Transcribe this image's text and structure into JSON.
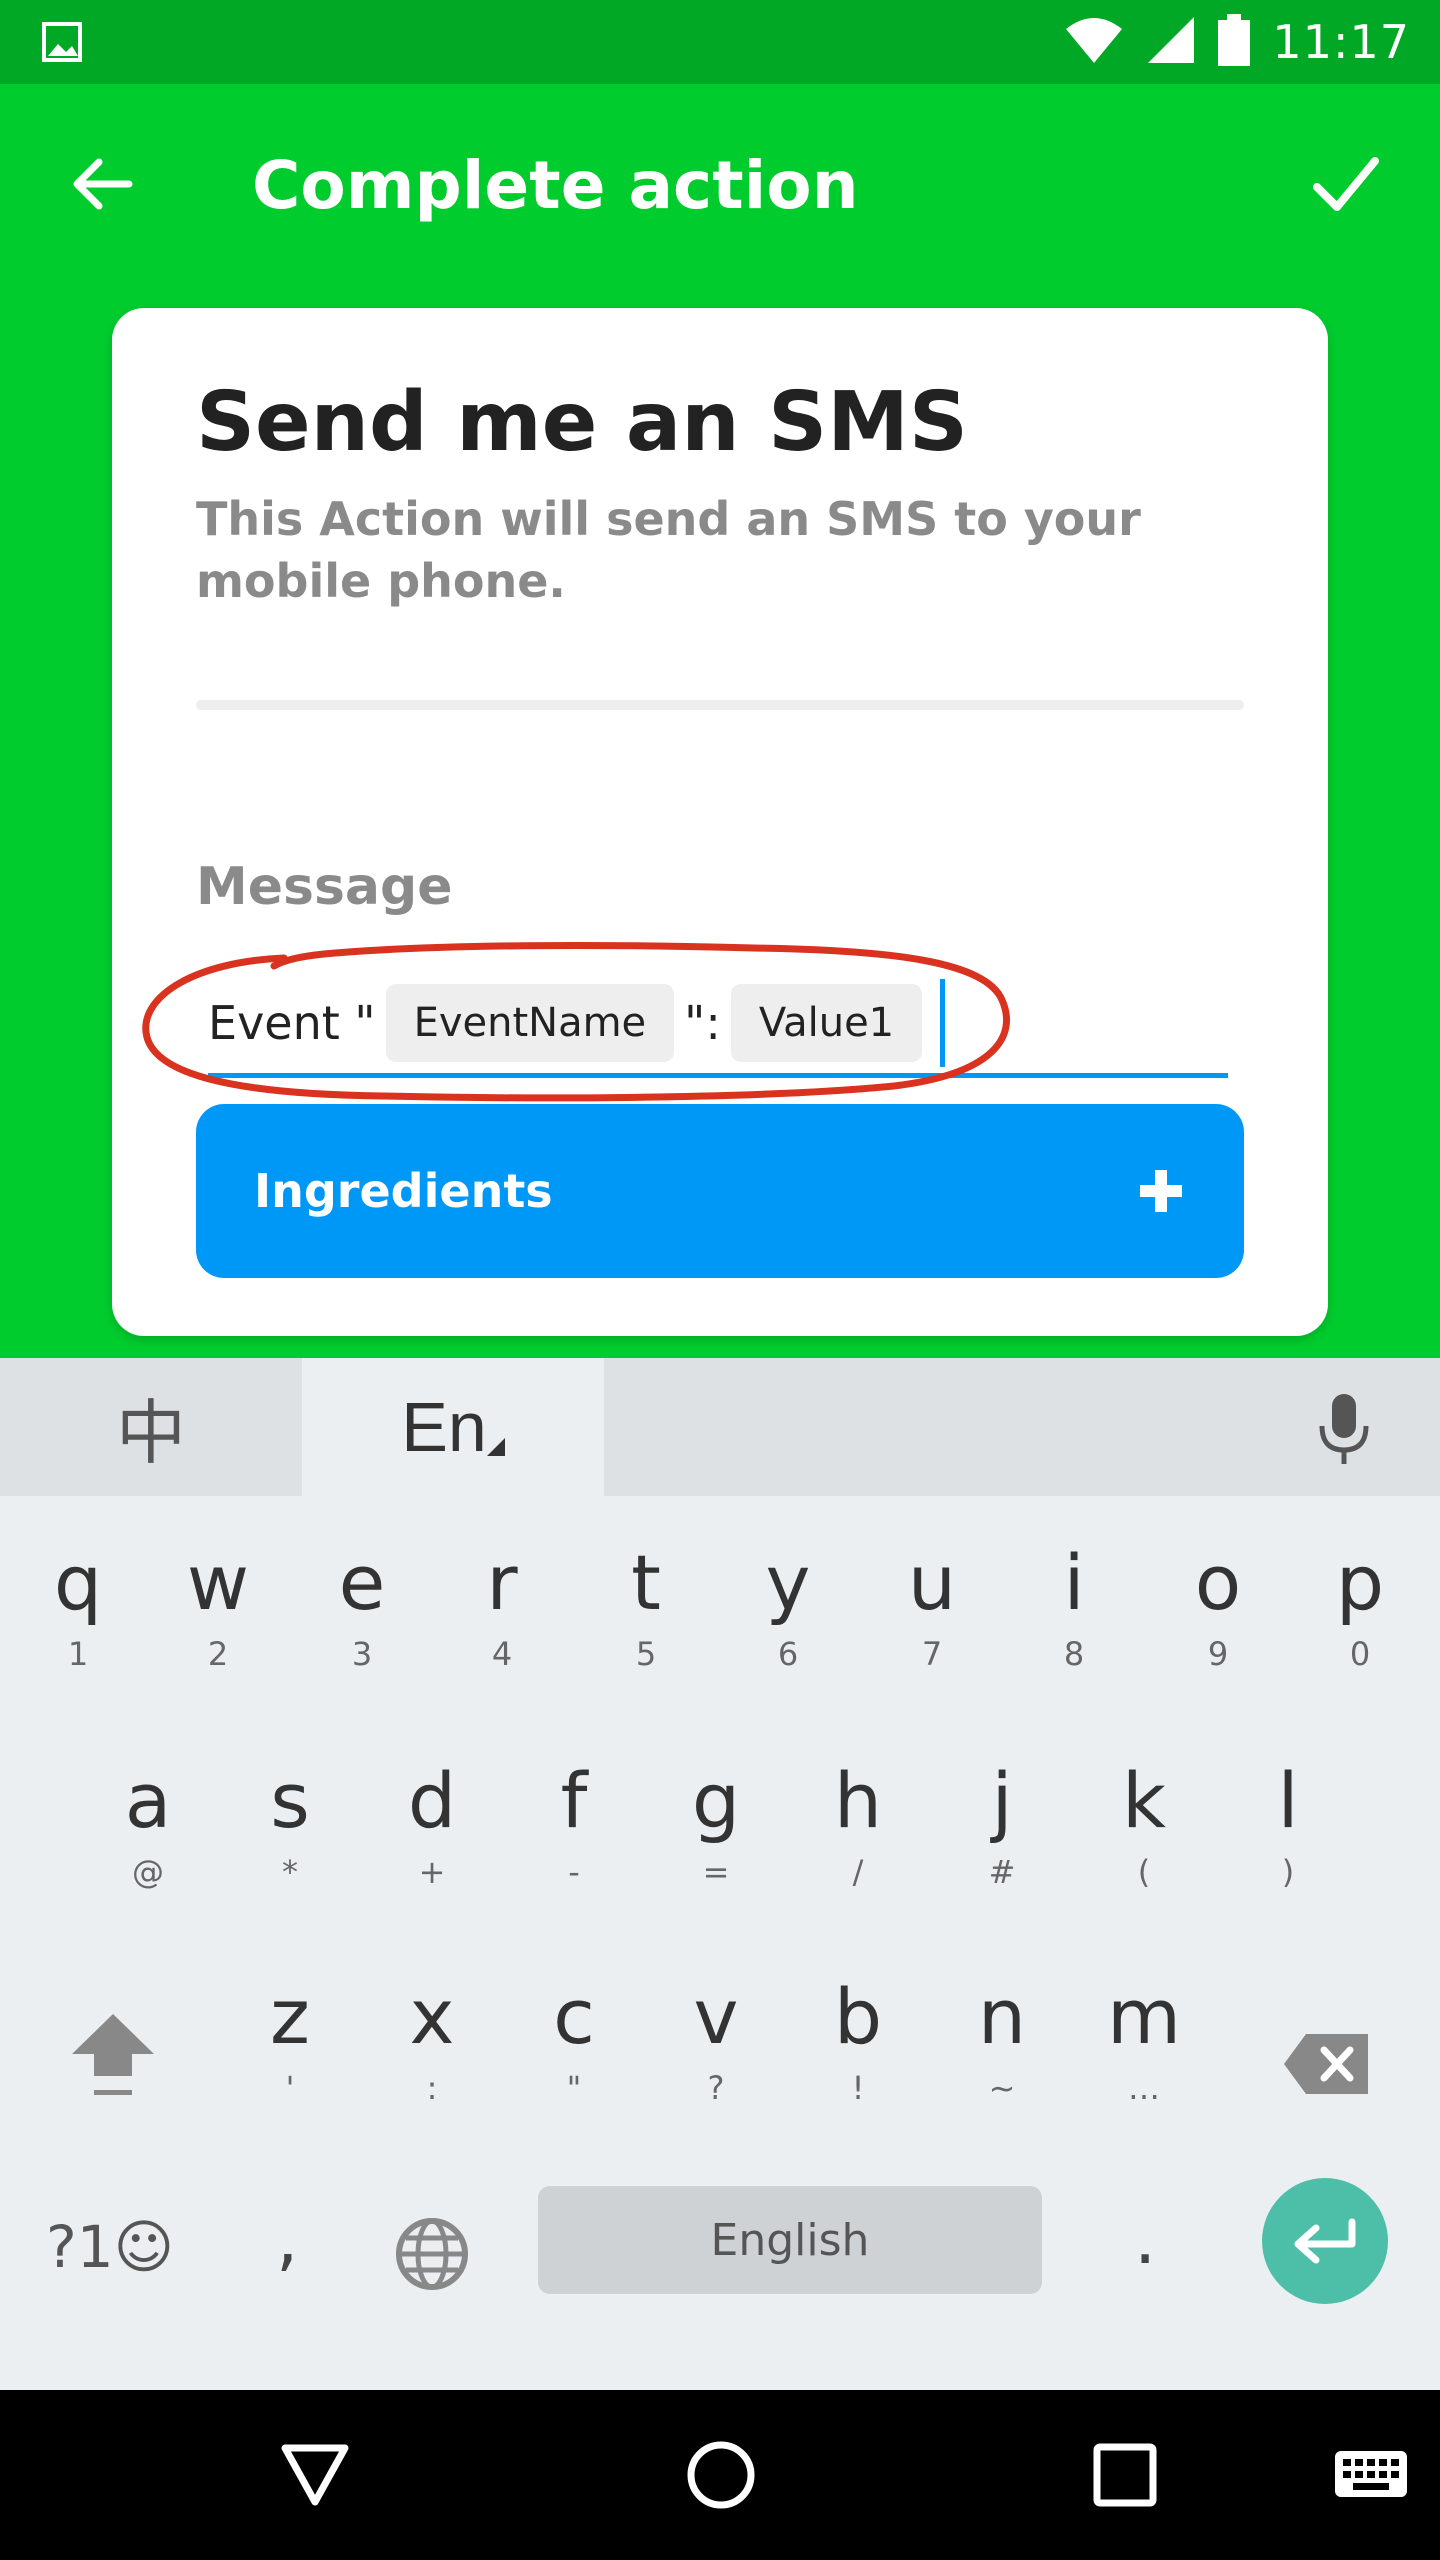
{
  "status_bar": {
    "time": "11:17",
    "icons": [
      "image-notification-icon",
      "wifi-icon",
      "signal-icon",
      "battery-icon"
    ]
  },
  "app_bar": {
    "title": "Complete action",
    "back_icon": "arrow-back-icon",
    "confirm_icon": "check-icon"
  },
  "card": {
    "title": "Send me an SMS",
    "description": "This Action will send an SMS to your mobile phone.",
    "field_label": "Message",
    "message": {
      "prefix": "Event \"",
      "chip1": "EventName",
      "middle": "\":",
      "chip2": "Value1"
    },
    "ingredients_label": "Ingredients",
    "highlight_color": "#d9321f"
  },
  "keyboard": {
    "tab_chinese": "中",
    "tab_english": "En",
    "row1": [
      {
        "key": "q",
        "sub": "1"
      },
      {
        "key": "w",
        "sub": "2"
      },
      {
        "key": "e",
        "sub": "3"
      },
      {
        "key": "r",
        "sub": "4"
      },
      {
        "key": "t",
        "sub": "5"
      },
      {
        "key": "y",
        "sub": "6"
      },
      {
        "key": "u",
        "sub": "7"
      },
      {
        "key": "i",
        "sub": "8"
      },
      {
        "key": "o",
        "sub": "9"
      },
      {
        "key": "p",
        "sub": "0"
      }
    ],
    "row2": [
      {
        "key": "a",
        "sub": "@"
      },
      {
        "key": "s",
        "sub": "*"
      },
      {
        "key": "d",
        "sub": "+"
      },
      {
        "key": "f",
        "sub": "-"
      },
      {
        "key": "g",
        "sub": "="
      },
      {
        "key": "h",
        "sub": "/"
      },
      {
        "key": "j",
        "sub": "#"
      },
      {
        "key": "k",
        "sub": "("
      },
      {
        "key": "l",
        "sub": ")"
      }
    ],
    "row3": [
      {
        "key": "z",
        "sub": "'"
      },
      {
        "key": "x",
        "sub": ":"
      },
      {
        "key": "c",
        "sub": "\""
      },
      {
        "key": "v",
        "sub": "?"
      },
      {
        "key": "b",
        "sub": "!"
      },
      {
        "key": "n",
        "sub": "~"
      },
      {
        "key": "m",
        "sub": "…"
      }
    ],
    "symbols_label": "?1☺",
    "comma": ",",
    "space_label": "English",
    "period": ".",
    "accent_color": "#4dbfa8"
  },
  "nav_bar": {
    "icons": [
      "back-triangle-icon",
      "home-circle-icon",
      "recents-square-icon",
      "keyboard-switch-icon"
    ]
  },
  "colors": {
    "brand_green": "#00cc2d",
    "status_green": "#00a825",
    "accent_blue": "#0098f7"
  }
}
